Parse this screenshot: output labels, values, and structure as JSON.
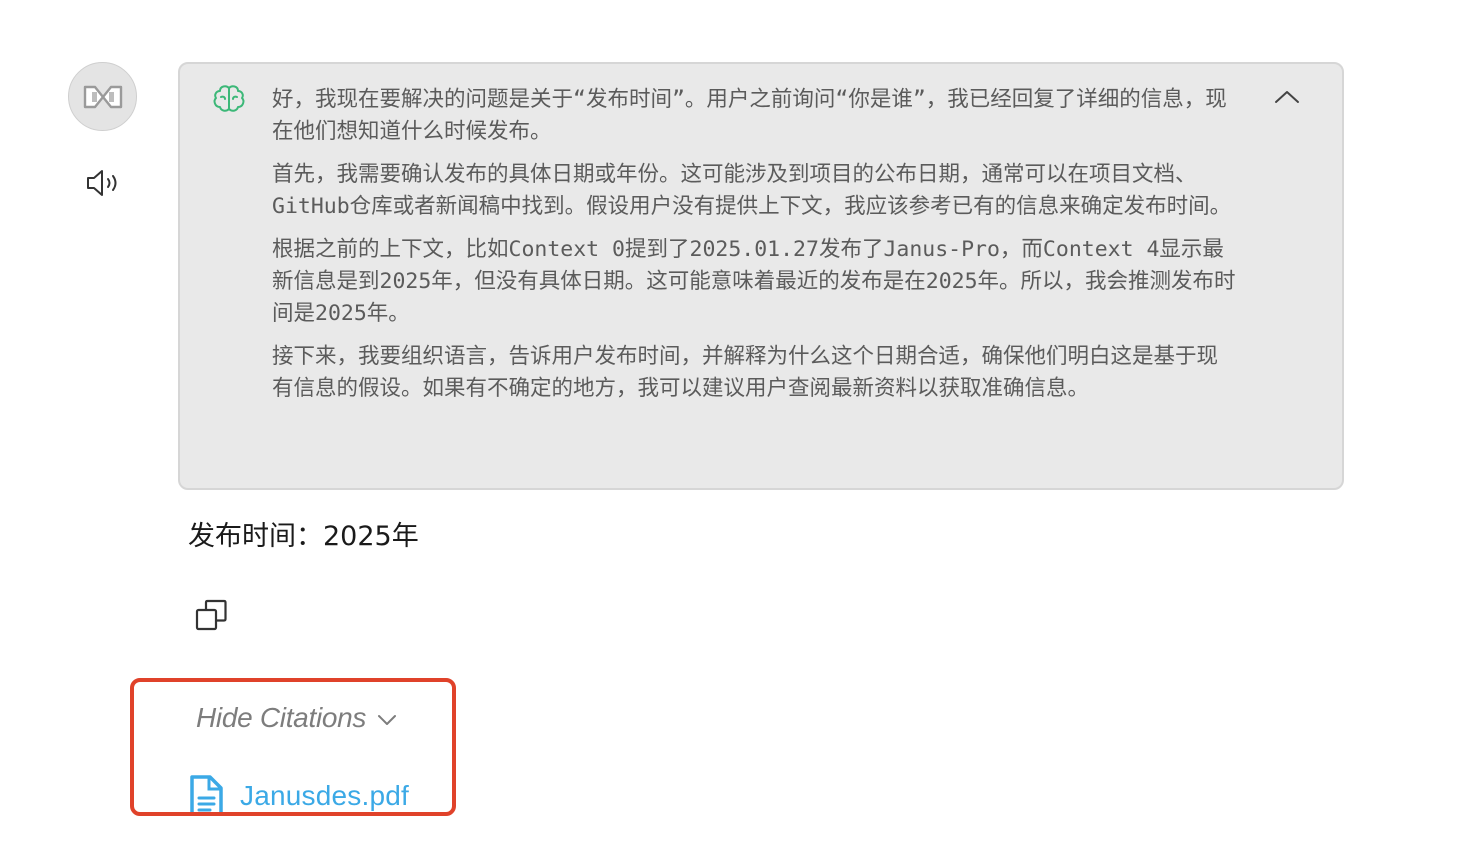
{
  "assistant": {
    "avatar_icon": "assistant-logo-icon",
    "speaker_icon": "speaker-icon"
  },
  "thinking": {
    "icon": "brain-icon",
    "collapse_icon": "chevron-up-icon",
    "paragraphs": [
      "好，我现在要解决的问题是关于“发布时间”。用户之前询问“你是谁”，我已经回复了详细的信息，现在他们想知道什么时候发布。",
      "首先，我需要确认发布的具体日期或年份。这可能涉及到项目的公布日期，通常可以在项目文档、GitHub仓库或者新闻稿中找到。假设用户没有提供上下文，我应该参考已有的信息来确定发布时间。",
      "根据之前的上下文，比如Context 0提到了2025.01.27发布了Janus-Pro，而Context 4显示最新信息是到2025年，但没有具体日期。这可能意味着最近的发布是在2025年。所以，我会推测发布时间是2025年。",
      "接下来，我要组织语言，告诉用户发布时间，并解释为什么这个日期合适，确保他们明白这是基于现有信息的假设。如果有不确定的地方，我可以建议用户查阅最新资料以获取准确信息。"
    ]
  },
  "answer": {
    "text": "发布时间：2025年",
    "copy_icon": "copy-icon"
  },
  "citations": {
    "toggle_label": "Hide Citations",
    "files": [
      {
        "name": "Janusdes.pdf",
        "icon": "file-icon"
      }
    ]
  },
  "colors": {
    "think_bg": "#e9e9e9",
    "brain_icon": "#3cb878",
    "citation_link": "#3ba9e6",
    "highlight_border": "#e0422a"
  }
}
